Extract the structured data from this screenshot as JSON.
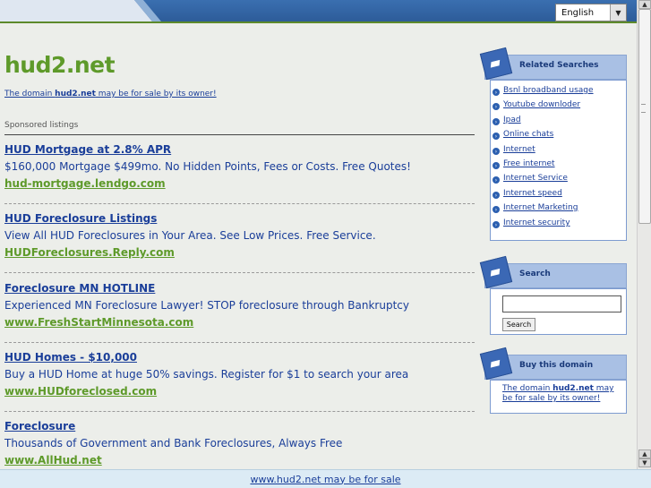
{
  "header": {
    "language": "English"
  },
  "main": {
    "site_title": "hud2.net",
    "sale_notice": {
      "prefix": "The domain ",
      "domain": "hud2.net",
      "suffix": " may be for sale by its owner!"
    },
    "sponsored_label": "Sponsored listings",
    "listings": [
      {
        "title": "HUD Mortgage at 2.8% APR",
        "description": "$160,000 Mortgage $499mo. No Hidden Points, Fees or Costs. Free Quotes!",
        "url": "hud-mortgage.lendgo.com"
      },
      {
        "title": "HUD Foreclosure Listings",
        "description": "View All HUD Foreclosures in Your Area. See Low Prices. Free Service.",
        "url": "HUDForeclosures.Reply.com"
      },
      {
        "title": "Foreclosure MN HOTLINE",
        "description": "Experienced MN Foreclosure Lawyer! STOP foreclosure through Bankruptcy",
        "url": "www.FreshStartMinnesota.com"
      },
      {
        "title": "HUD Homes - $10,000",
        "description": "Buy a HUD Home at huge 50% savings. Register for $1 to search your area",
        "url": "www.HUDforeclosed.com"
      },
      {
        "title": "Foreclosure",
        "description": "Thousands of Government and Bank Foreclosures, Always Free",
        "url": "www.AllHud.net"
      }
    ]
  },
  "sidebar": {
    "related": {
      "title": "Related Searches",
      "items": [
        "Bsnl broadband usage",
        "Youtube downloder",
        "Ipad",
        "Online chats",
        "Internet",
        "Free internet",
        "Internet Service",
        "Internet speed",
        "Internet Marketing",
        "Internet security"
      ]
    },
    "search": {
      "title": "Search",
      "button_label": "Search"
    },
    "buy": {
      "title": "Buy this domain",
      "prefix": "The domain ",
      "domain": "hud2.net",
      "suffix": " may be for sale by its owner!"
    }
  },
  "footer": {
    "link": "www.hud2.net may be for sale"
  },
  "colors": {
    "accent_blue": "#1a3e99",
    "brand_green": "#5e9a2a",
    "header_blue": "#2c5a97"
  }
}
